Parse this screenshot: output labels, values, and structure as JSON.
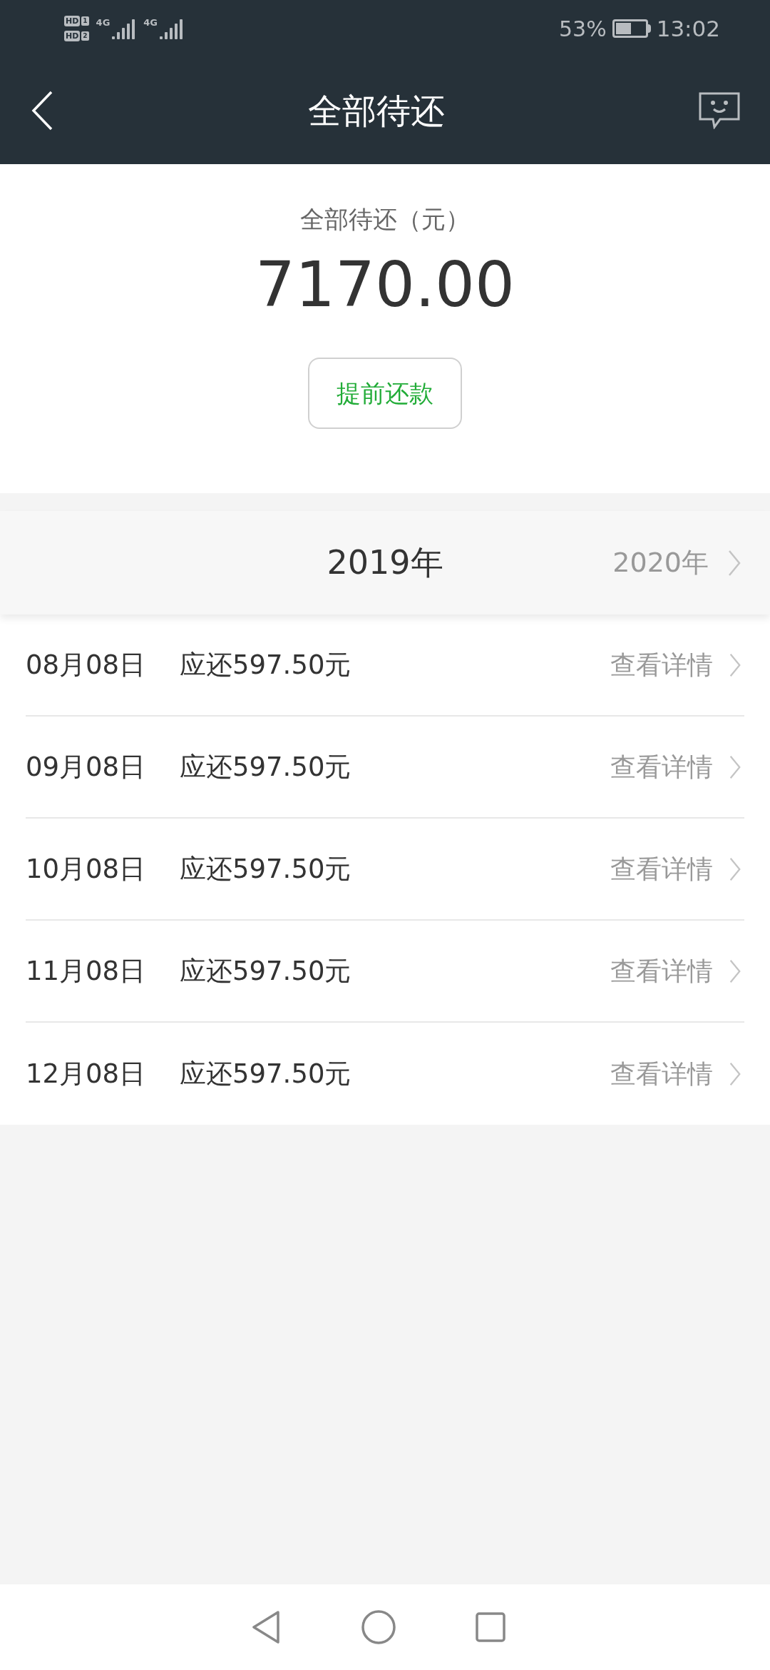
{
  "status_bar": {
    "sims": [
      {
        "badge": "HD",
        "slot": "1",
        "network": "4G"
      },
      {
        "badge": "HD",
        "slot": "2",
        "network": "4G"
      }
    ],
    "battery_text": "53%",
    "battery": {
      "level": 0.53
    },
    "time": "13:02"
  },
  "header": {
    "title": "全部待还"
  },
  "summary": {
    "label": "全部待还（元）",
    "amount": "7170.00",
    "button": "提前还款"
  },
  "years": [
    {
      "label": "2019年",
      "selected": true
    },
    {
      "label": "2020年",
      "selected": false
    }
  ],
  "rows": [
    {
      "date": "08月08日",
      "amount": "应还597.50元",
      "link": "查看详情"
    },
    {
      "date": "09月08日",
      "amount": "应还597.50元",
      "link": "查看详情"
    },
    {
      "date": "10月08日",
      "amount": "应还597.50元",
      "link": "查看详情"
    },
    {
      "date": "11月08日",
      "amount": "应还597.50元",
      "link": "查看详情"
    },
    {
      "date": "12月08日",
      "amount": "应还597.50元",
      "link": "查看详情"
    }
  ]
}
